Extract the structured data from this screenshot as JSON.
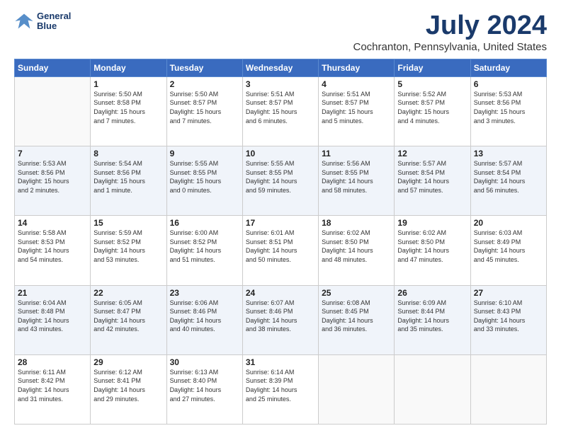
{
  "logo": {
    "line1": "General",
    "line2": "Blue"
  },
  "title": "July 2024",
  "subtitle": "Cochranton, Pennsylvania, United States",
  "headers": [
    "Sunday",
    "Monday",
    "Tuesday",
    "Wednesday",
    "Thursday",
    "Friday",
    "Saturday"
  ],
  "weeks": [
    [
      {
        "day": "",
        "info": ""
      },
      {
        "day": "1",
        "info": "Sunrise: 5:50 AM\nSunset: 8:58 PM\nDaylight: 15 hours\nand 7 minutes."
      },
      {
        "day": "2",
        "info": "Sunrise: 5:50 AM\nSunset: 8:57 PM\nDaylight: 15 hours\nand 7 minutes."
      },
      {
        "day": "3",
        "info": "Sunrise: 5:51 AM\nSunset: 8:57 PM\nDaylight: 15 hours\nand 6 minutes."
      },
      {
        "day": "4",
        "info": "Sunrise: 5:51 AM\nSunset: 8:57 PM\nDaylight: 15 hours\nand 5 minutes."
      },
      {
        "day": "5",
        "info": "Sunrise: 5:52 AM\nSunset: 8:57 PM\nDaylight: 15 hours\nand 4 minutes."
      },
      {
        "day": "6",
        "info": "Sunrise: 5:53 AM\nSunset: 8:56 PM\nDaylight: 15 hours\nand 3 minutes."
      }
    ],
    [
      {
        "day": "7",
        "info": "Sunrise: 5:53 AM\nSunset: 8:56 PM\nDaylight: 15 hours\nand 2 minutes."
      },
      {
        "day": "8",
        "info": "Sunrise: 5:54 AM\nSunset: 8:56 PM\nDaylight: 15 hours\nand 1 minute."
      },
      {
        "day": "9",
        "info": "Sunrise: 5:55 AM\nSunset: 8:55 PM\nDaylight: 15 hours\nand 0 minutes."
      },
      {
        "day": "10",
        "info": "Sunrise: 5:55 AM\nSunset: 8:55 PM\nDaylight: 14 hours\nand 59 minutes."
      },
      {
        "day": "11",
        "info": "Sunrise: 5:56 AM\nSunset: 8:55 PM\nDaylight: 14 hours\nand 58 minutes."
      },
      {
        "day": "12",
        "info": "Sunrise: 5:57 AM\nSunset: 8:54 PM\nDaylight: 14 hours\nand 57 minutes."
      },
      {
        "day": "13",
        "info": "Sunrise: 5:57 AM\nSunset: 8:54 PM\nDaylight: 14 hours\nand 56 minutes."
      }
    ],
    [
      {
        "day": "14",
        "info": "Sunrise: 5:58 AM\nSunset: 8:53 PM\nDaylight: 14 hours\nand 54 minutes."
      },
      {
        "day": "15",
        "info": "Sunrise: 5:59 AM\nSunset: 8:52 PM\nDaylight: 14 hours\nand 53 minutes."
      },
      {
        "day": "16",
        "info": "Sunrise: 6:00 AM\nSunset: 8:52 PM\nDaylight: 14 hours\nand 51 minutes."
      },
      {
        "day": "17",
        "info": "Sunrise: 6:01 AM\nSunset: 8:51 PM\nDaylight: 14 hours\nand 50 minutes."
      },
      {
        "day": "18",
        "info": "Sunrise: 6:02 AM\nSunset: 8:50 PM\nDaylight: 14 hours\nand 48 minutes."
      },
      {
        "day": "19",
        "info": "Sunrise: 6:02 AM\nSunset: 8:50 PM\nDaylight: 14 hours\nand 47 minutes."
      },
      {
        "day": "20",
        "info": "Sunrise: 6:03 AM\nSunset: 8:49 PM\nDaylight: 14 hours\nand 45 minutes."
      }
    ],
    [
      {
        "day": "21",
        "info": "Sunrise: 6:04 AM\nSunset: 8:48 PM\nDaylight: 14 hours\nand 43 minutes."
      },
      {
        "day": "22",
        "info": "Sunrise: 6:05 AM\nSunset: 8:47 PM\nDaylight: 14 hours\nand 42 minutes."
      },
      {
        "day": "23",
        "info": "Sunrise: 6:06 AM\nSunset: 8:46 PM\nDaylight: 14 hours\nand 40 minutes."
      },
      {
        "day": "24",
        "info": "Sunrise: 6:07 AM\nSunset: 8:46 PM\nDaylight: 14 hours\nand 38 minutes."
      },
      {
        "day": "25",
        "info": "Sunrise: 6:08 AM\nSunset: 8:45 PM\nDaylight: 14 hours\nand 36 minutes."
      },
      {
        "day": "26",
        "info": "Sunrise: 6:09 AM\nSunset: 8:44 PM\nDaylight: 14 hours\nand 35 minutes."
      },
      {
        "day": "27",
        "info": "Sunrise: 6:10 AM\nSunset: 8:43 PM\nDaylight: 14 hours\nand 33 minutes."
      }
    ],
    [
      {
        "day": "28",
        "info": "Sunrise: 6:11 AM\nSunset: 8:42 PM\nDaylight: 14 hours\nand 31 minutes."
      },
      {
        "day": "29",
        "info": "Sunrise: 6:12 AM\nSunset: 8:41 PM\nDaylight: 14 hours\nand 29 minutes."
      },
      {
        "day": "30",
        "info": "Sunrise: 6:13 AM\nSunset: 8:40 PM\nDaylight: 14 hours\nand 27 minutes."
      },
      {
        "day": "31",
        "info": "Sunrise: 6:14 AM\nSunset: 8:39 PM\nDaylight: 14 hours\nand 25 minutes."
      },
      {
        "day": "",
        "info": ""
      },
      {
        "day": "",
        "info": ""
      },
      {
        "day": "",
        "info": ""
      }
    ]
  ]
}
